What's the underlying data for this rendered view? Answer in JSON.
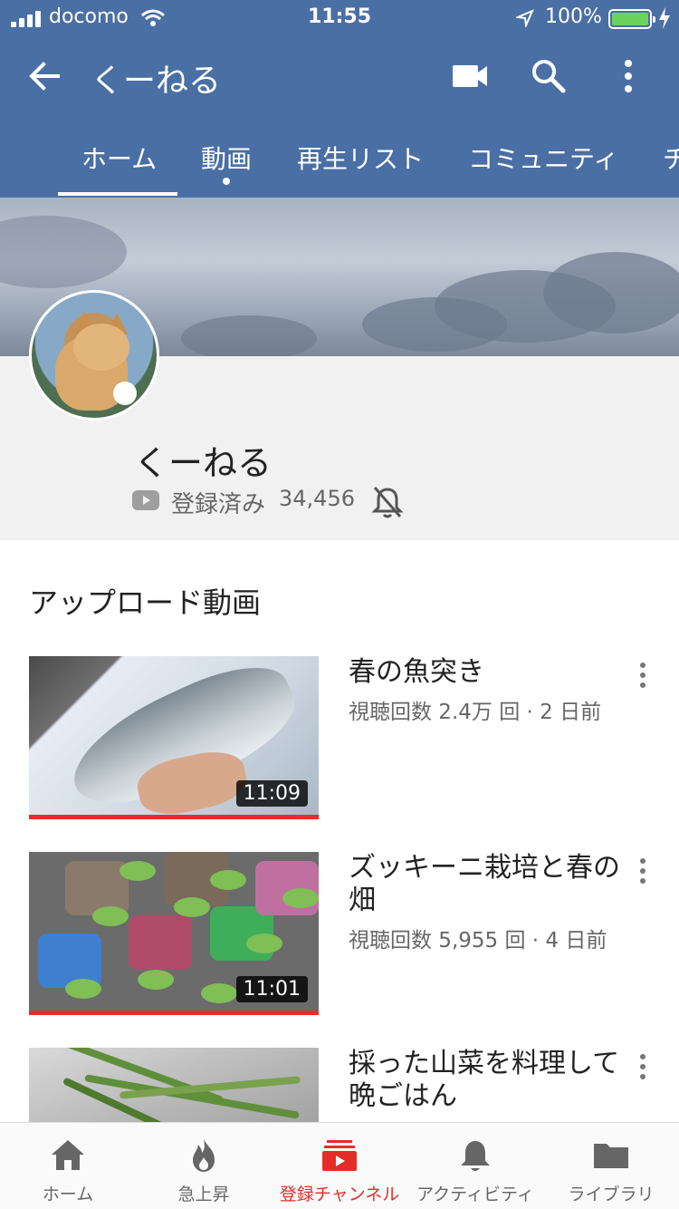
{
  "status_bar": {
    "carrier": "docomo",
    "time": "11:55",
    "battery": "100%"
  },
  "app_bar": {
    "title": "くーねる"
  },
  "tabs": [
    {
      "label": "ホーム"
    },
    {
      "label": "動画"
    },
    {
      "label": "再生リスト"
    },
    {
      "label": "コミュニティ"
    },
    {
      "label": "チ"
    }
  ],
  "channel": {
    "name": "くーねる",
    "subscribed_label": "登録済み",
    "subscriber_count": "34,456"
  },
  "uploads": {
    "section_title": "アップロード動画",
    "videos": [
      {
        "title": "春の魚突き",
        "meta": "視聴回数 2.4万 回 · 2 日前",
        "duration": "11:09"
      },
      {
        "title": "ズッキーニ栽培と春の畑",
        "meta": "視聴回数 5,955 回 · 4 日前",
        "duration": "11:01"
      },
      {
        "title": "採った山菜を料理して晩ごはん",
        "meta": "",
        "duration": ""
      }
    ]
  },
  "bottom_nav": [
    {
      "label": "ホーム",
      "icon": "home-icon"
    },
    {
      "label": "急上昇",
      "icon": "flame-icon"
    },
    {
      "label": "登録チャンネル",
      "icon": "subscriptions-icon"
    },
    {
      "label": "アクティビティ",
      "icon": "bell-icon"
    },
    {
      "label": "ライブラリ",
      "icon": "folder-icon"
    }
  ],
  "colors": {
    "app_bar": "#4a6fa5",
    "accent": "#e52d27"
  }
}
